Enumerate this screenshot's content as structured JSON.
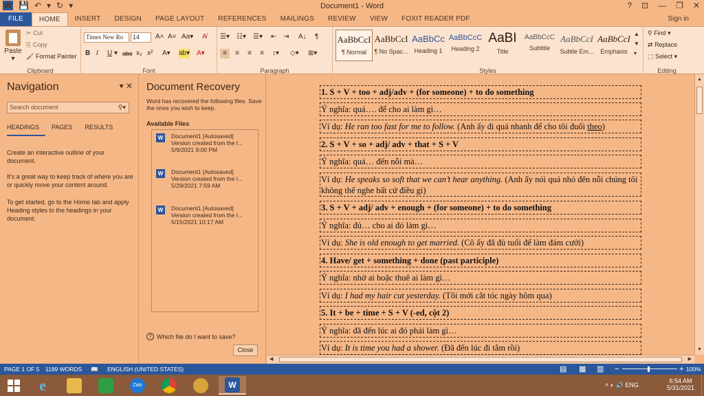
{
  "window": {
    "title": "Document1 - Word",
    "help": "?",
    "ribbon_display": "⊡",
    "minimize": "—",
    "restore": "❐",
    "close": "✕"
  },
  "qat": {
    "save": "💾",
    "undo": "↶",
    "undo_arrow": "▾",
    "redo": "↻",
    "customize": "▾"
  },
  "tabs": [
    "FILE",
    "HOME",
    "INSERT",
    "DESIGN",
    "PAGE LAYOUT",
    "REFERENCES",
    "MAILINGS",
    "REVIEW",
    "VIEW",
    "FOXIT READER PDF"
  ],
  "sign_in": "Sign in",
  "ribbon": {
    "clipboard": {
      "label": "Clipboard",
      "paste": "Paste",
      "paste_arrow": "▾",
      "cut": "Cut",
      "copy": "Copy",
      "format_painter": "Format Painter"
    },
    "font": {
      "label": "Font",
      "name": "Times New Ro",
      "size": "14",
      "grow": "A˄",
      "shrink": "A˅",
      "case": "Aa▾",
      "clear": "A̸",
      "bold": "B",
      "italic": "I",
      "underline": "U",
      "underline_arrow": "▾",
      "strike": "abc",
      "sub": "x₂",
      "sup": "x²",
      "effects": "A▾",
      "highlight": "ab▾",
      "color": "A▾"
    },
    "paragraph": {
      "label": "Paragraph",
      "bullets": "☰▾",
      "numbering": "☷▾",
      "multilevel": "☰▾",
      "decrease": "⇤",
      "increase": "⇥",
      "sort": "A↓",
      "marks": "¶",
      "align_left": "≡",
      "center": "≡",
      "align_right": "≡",
      "justify": "≡",
      "spacing": "↕▾",
      "shading": "◇▾",
      "borders": "⊞▾"
    },
    "styles": {
      "label": "Styles",
      "items": [
        {
          "preview": "AaBbCcI",
          "name": "¶ Normal"
        },
        {
          "preview": "AaBbCcI",
          "name": "¶ No Spac..."
        },
        {
          "preview": "AaBbCc",
          "name": "Heading 1"
        },
        {
          "preview": "AaBbCcC",
          "name": "Heading 2"
        },
        {
          "preview": "AaBI",
          "name": "Title"
        },
        {
          "preview": "AaBbCcC",
          "name": "Subtitle"
        },
        {
          "preview": "AaBbCcI",
          "name": "Subtle Em..."
        },
        {
          "preview": "AaBbCcI",
          "name": "Emphasis"
        }
      ]
    },
    "editing": {
      "label": "Editing",
      "find": "Find",
      "find_arrow": "▾",
      "replace": "Replace",
      "select": "Select",
      "select_arrow": "▾"
    }
  },
  "navigation": {
    "title": "Navigation",
    "options": "▾",
    "close": "✕",
    "search_placeholder": "Search document",
    "search_icon": "⚲▾",
    "tabs": [
      "HEADINGS",
      "PAGES",
      "RESULTS"
    ],
    "paragraphs": [
      "Create an interactive outline of your document.",
      "It's a great way to keep track of where you are or quickly move your content around.",
      "To get started, go to the Home tab and apply Heading styles to the headings in your document."
    ]
  },
  "recovery": {
    "title": "Document Recovery",
    "desc": "Word has recovered the following files. Save the ones you wish to keep.",
    "available": "Available Files",
    "files": [
      {
        "name": "Document1  [Autosaved]",
        "version": "Version created from the l...",
        "date": "5/9/2021 9:00 PM"
      },
      {
        "name": "Document1  [Autosaved]",
        "version": "Version created from the l...",
        "date": "5/29/2021 7:59 AM"
      },
      {
        "name": "Document1  [Autosaved]",
        "version": "Version created from the l...",
        "date": "5/15/2021 10:17 AM"
      }
    ],
    "help": "Which file do I want to save?",
    "help_icon": "?",
    "close": "Close"
  },
  "document": {
    "rows": [
      {
        "bold": true,
        "text": "1. S + V + too + adj/adv + (for someone) + to do something"
      },
      {
        "text": "Ý nghĩa: quá…. để cho ai làm gì…"
      },
      {
        "pre": "Ví dụ: ",
        "ital": "He ran too fast for me to follow.",
        "post": " (Anh ấy đi quá nhanh để cho tôi đuổi ",
        "under": "theo",
        "tail": ")"
      },
      {
        "bold": true,
        "text": "2.  S + V + so + adj/ adv + that + S + V"
      },
      {
        "text": "Ý nghĩa: quá… đến nỗi mà…"
      },
      {
        "pre": "Ví dụ: ",
        "ital": "He speaks so soft that we can’t hear anything.",
        "post": " (Anh ấy nói quá nhỏ đến nỗi chúng tôi không thể nghe bất cứ điều gì)"
      },
      {
        "bold": true,
        "text": "3. S + V + adj/ adv + enough + (for someone) + to do something"
      },
      {
        "text": "Ý nghĩa: đủ… cho ai đó làm gì…"
      },
      {
        "pre": "Ví dụ: ",
        "ital": "She is old enough to get married.",
        "post": " (Cô ấy đã đủ tuổi để làm đám cưới)"
      },
      {
        "bold": true,
        "text": "4. Have/ get + something + done (past participle)"
      },
      {
        "text": "Ý nghĩa: nhờ ai hoặc thuê ai làm gì…"
      },
      {
        "pre": "Ví dụ: ",
        "ital": "I had my hair cut yesterday.",
        "post": " (Tôi mới cắt tóc ngày hôm qua)"
      },
      {
        "bold": true,
        "text": "5. It + be + time + S + V (-ed, cột 2)"
      },
      {
        "text": "Ý nghĩa: đã đến lúc ai đó phải làm gì…"
      },
      {
        "pre": "Ví dụ: ",
        "ital": "It is time you had a shower.",
        "post": " (Đã đến lúc đi tắm rồi)"
      }
    ]
  },
  "status": {
    "page": "PAGE 1 OF 5",
    "words": "1189 WORDS",
    "proof_icon": "📖",
    "language": "ENGLISH (UNITED STATES)",
    "read_mode": "▤",
    "print_layout": "▦",
    "web_layout": "▥",
    "zoom_out": "−",
    "zoom_in": "+",
    "zoom": "100%"
  },
  "taskbar": {
    "apps": [
      "start",
      "internet-explorer",
      "file-explorer",
      "store",
      "zalo",
      "chrome",
      "unikey",
      "word"
    ],
    "zalo_label": "Zalo",
    "tray_icons": "˄  ◐  🔊  ENG",
    "time": "6:54 AM",
    "date": "5/31/2021"
  }
}
